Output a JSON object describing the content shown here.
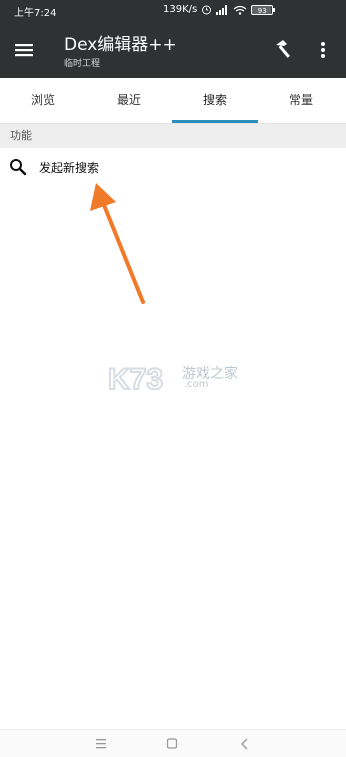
{
  "status_bar": {
    "time": "上午7:24",
    "net_speed": "139K/s",
    "battery": "93",
    "icons": [
      "alarm-icon",
      "signal-icon",
      "wifi-icon",
      "battery-icon"
    ]
  },
  "app_bar": {
    "title": "Dex编辑器++",
    "subtitle": "临时工程",
    "icons": [
      "menu-icon",
      "hammer-icon",
      "more-vert-icon"
    ]
  },
  "tabs": [
    {
      "label": "浏览",
      "active": false
    },
    {
      "label": "最近",
      "active": false
    },
    {
      "label": "搜索",
      "active": true
    },
    {
      "label": "常量",
      "active": false
    }
  ],
  "section": {
    "title": "功能"
  },
  "list": [
    {
      "label": "发起新搜索",
      "icon": "search-icon"
    }
  ],
  "watermark": {
    "text": "游戏之家",
    "sub": ".com"
  },
  "colors": {
    "app_bar_bg": "#2f3133",
    "tab_indicator": "#2a8fbd",
    "arrow": "#f0792a"
  },
  "nav_bar": {
    "icons": [
      "menu-lines-icon",
      "home-square-icon",
      "back-chevron-icon"
    ]
  }
}
